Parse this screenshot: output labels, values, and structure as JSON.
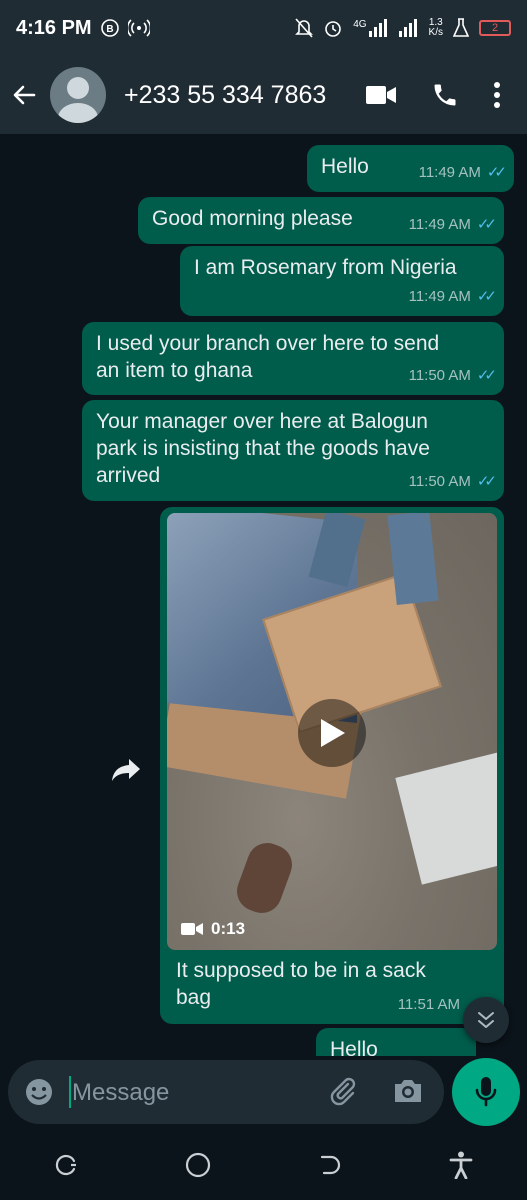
{
  "status_bar": {
    "time": "4:16 PM",
    "icons": [
      "b-badge-icon",
      "hotspot-icon",
      "mute-icon",
      "alarm-icon",
      "signal-icon",
      "signal-icon",
      "flask-icon"
    ],
    "network": "4G",
    "net_speed_value": "1.3",
    "net_speed_unit": "K/s",
    "battery": "2"
  },
  "header": {
    "contact_name": "+233 55 334 7863",
    "actions": [
      "video-call-icon",
      "voice-call-icon",
      "more-options-icon"
    ]
  },
  "messages": [
    {
      "text": "Hello",
      "time": "11:49 AM",
      "status": "read"
    },
    {
      "text": "Good morning please",
      "time": "11:49 AM",
      "status": "read"
    },
    {
      "text": "I am Rosemary from Nigeria",
      "time": "11:49 AM",
      "status": "read"
    },
    {
      "text": "I used your branch over here to send\nan item to ghana",
      "time": "11:50 AM",
      "status": "read"
    },
    {
      "text": "Your manager over here at Balogun\npark is insisting that the goods have\narrived",
      "time": "11:50 AM",
      "status": "read"
    },
    {
      "type": "video",
      "duration": "0:13",
      "caption": "It supposed to be in a sack\nbag",
      "time": "11:51 AM"
    },
    {
      "text": "Hello",
      "time": "",
      "status": "read"
    }
  ],
  "composer": {
    "placeholder": "Message",
    "value": ""
  },
  "colors": {
    "outgoing_bubble": "#005c4b",
    "background": "#0b141a",
    "bar": "#1f2c34",
    "accent": "#00a884",
    "read_ticks": "#53bdeb"
  }
}
